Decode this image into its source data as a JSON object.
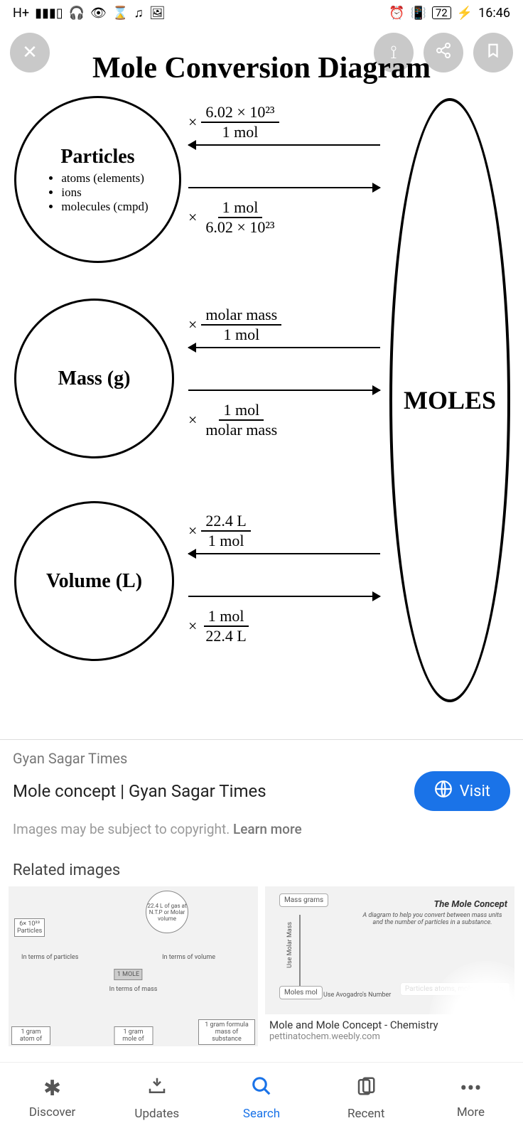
{
  "status": {
    "network": "H+",
    "battery": "72",
    "time": "16:46"
  },
  "diagram": {
    "title": "Mole Conversion Diagram",
    "moles": "MOLES",
    "circles": {
      "particles": {
        "title": "Particles",
        "items": [
          "atoms (elements)",
          "ions",
          "molecules (cmpd)"
        ]
      },
      "mass": {
        "title": "Mass (g)"
      },
      "volume": {
        "title": "Volume (L)"
      }
    },
    "conv": {
      "p_from": {
        "n": "6.02 × 10²³",
        "d": "1 mol"
      },
      "p_to": {
        "n": "1 mol",
        "d": "6.02 × 10²³"
      },
      "m_from": {
        "n": "molar mass",
        "d": "1 mol"
      },
      "m_to": {
        "n": "1 mol",
        "d": "molar mass"
      },
      "v_from": {
        "n": "22.4 L",
        "d": "1 mol"
      },
      "v_to": {
        "n": "1 mol",
        "d": "22.4 L"
      }
    }
  },
  "info": {
    "source": "Gyan Sagar Times",
    "title": "Mole concept | Gyan Sagar Times",
    "visit": "Visit",
    "copyright": "Images may be subject to copyright. ",
    "learn": "Learn more"
  },
  "related": {
    "header": "Related images",
    "thumb1": {
      "flask": "22.4 L of gas at N.T.P or Molar volume",
      "particles": "6× 10²³\nParticles",
      "molebox": "1 MOLE",
      "l1": "In terms of particles",
      "l2": "In terms of volume",
      "l3": "In terms of mass",
      "g1": "1 gram atom of",
      "g2": "1 gram mole of",
      "g3": "1 gram formula mass of substance"
    },
    "thumb2": {
      "title": "The Mole Concept",
      "subtitle": "A diagram to help you convert between mass units and the number of particles in a substance.",
      "mass": "Mass grams",
      "moles": "Moles mol",
      "molar": "Use Molar Mass",
      "avog": "Use Avogadro's Number",
      "part": "Particles atoms, molecules, etc.",
      "cap": "Mole and Mole Concept - Chemistry",
      "capsub": "pettinatochem.weebly.com"
    }
  },
  "nav": {
    "discover": "Discover",
    "updates": "Updates",
    "search": "Search",
    "recent": "Recent",
    "more": "More"
  }
}
